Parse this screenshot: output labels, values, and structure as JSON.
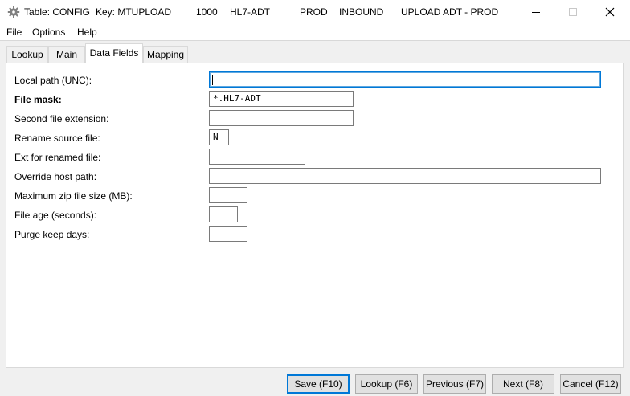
{
  "titlebar": {
    "table": "Table: CONFIG",
    "key": "Key: MTUPLOAD",
    "num": "1000",
    "type": "HL7-ADT",
    "env": "PROD",
    "direction": "INBOUND",
    "desc": "UPLOAD ADT - PROD"
  },
  "menu": [
    "File",
    "Options",
    "Help"
  ],
  "tabs": [
    "Lookup",
    "Main",
    "Data Fields",
    "Mapping"
  ],
  "active_tab": "Data Fields",
  "fields": [
    {
      "label": "Local path (UNC):",
      "value": ""
    },
    {
      "label": "File mask:",
      "value": "*.HL7-ADT"
    },
    {
      "label": "Second file extension:",
      "value": ""
    },
    {
      "label": "Rename source file:",
      "value": "N"
    },
    {
      "label": "Ext for renamed file:",
      "value": ""
    },
    {
      "label": "Override host path:",
      "value": ""
    },
    {
      "label": "Maximum zip file size (MB):",
      "value": ""
    },
    {
      "label": "File age (seconds):",
      "value": ""
    },
    {
      "label": "Purge keep days:",
      "value": ""
    }
  ],
  "buttons": {
    "save": "Save (F10)",
    "lookup": "Lookup (F6)",
    "previous": "Previous (F7)",
    "next": "Next (F8)",
    "cancel": "Cancel (F12)"
  },
  "colors": {
    "focus": "#0078d7",
    "panel_bg": "#ffffff",
    "client_bg": "#f0f0f0"
  },
  "icons": {
    "app": "gear-icon",
    "minimize": "minimize-icon",
    "maximize": "maximize-icon",
    "close": "close-icon"
  }
}
